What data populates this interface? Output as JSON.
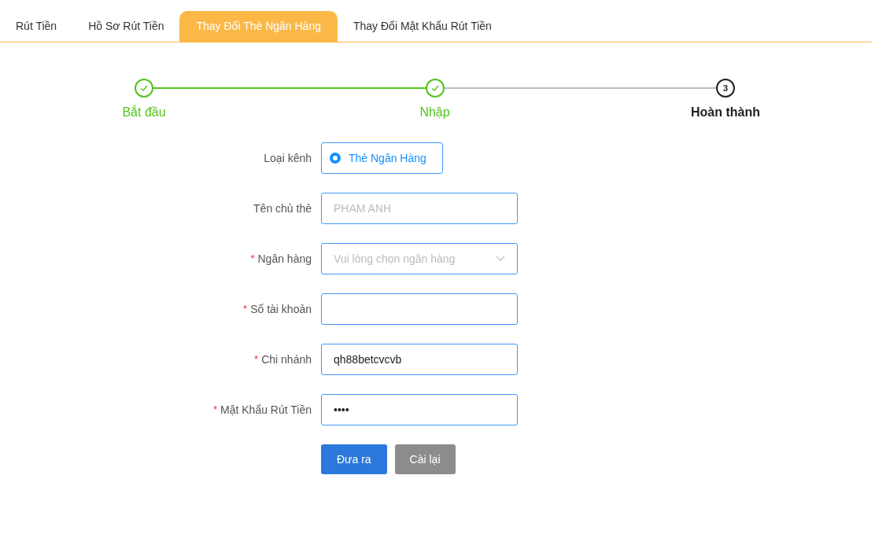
{
  "tabs": [
    {
      "label": "Rút Tiền",
      "selected": false
    },
    {
      "label": "Hồ Sơ Rút Tiền",
      "selected": false
    },
    {
      "label": "Thay Đổi Thẻ Ngân Hàng",
      "selected": true
    },
    {
      "label": "Thay Đổi Mật Khẩu Rút Tiền",
      "selected": false
    }
  ],
  "steps": [
    {
      "label": "Bắt đầu",
      "done": true
    },
    {
      "label": "Nhập",
      "done": true
    },
    {
      "label": "Hoàn thành",
      "done": false,
      "number": "3"
    }
  ],
  "form": {
    "fields": [
      {
        "kind": "radio",
        "label": "Loại kênh",
        "required": false,
        "option": "Thẻ Ngân Hàng",
        "selected": true
      },
      {
        "kind": "input",
        "label": "Tên chủ thẻ",
        "required": false,
        "placeholder": "PHAM ANH"
      },
      {
        "kind": "select",
        "label": "Ngân hàng",
        "required": true,
        "placeholder": "Vui lòng chọn ngân hàng"
      },
      {
        "kind": "input",
        "label": "Số tài khoản",
        "required": true
      },
      {
        "kind": "input",
        "label": "Chi nhánh",
        "required": true,
        "value": "qh88betcvcvb"
      },
      {
        "kind": "input",
        "label": "Mật Khẩu Rút Tiền",
        "required": true,
        "value": "••••"
      }
    ],
    "required_mark": "*",
    "buttons": [
      {
        "label": "Đưa ra",
        "kind": "primary"
      },
      {
        "label": "Cài lại",
        "kind": "secondary"
      }
    ]
  }
}
